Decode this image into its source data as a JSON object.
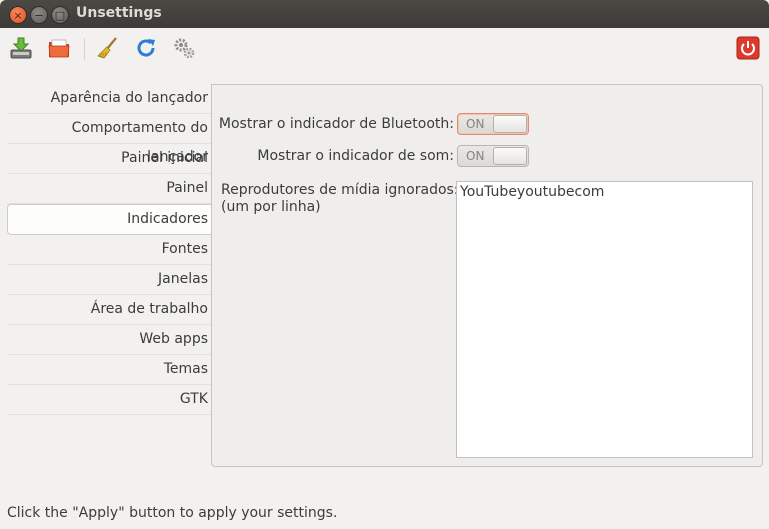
{
  "window": {
    "title": "Unsettings",
    "close": "×",
    "minimize": "−",
    "maximize": "□"
  },
  "toolbar": {
    "icons": [
      "save-icon",
      "folder-open-icon",
      "broom-icon",
      "refresh-icon",
      "gears-icon",
      "power-icon"
    ],
    "colors": {
      "save": "#5fa832",
      "folder": "#e8552a",
      "refresh": "#2a7fd4",
      "power": "#df382c"
    }
  },
  "sidebar": {
    "items": [
      {
        "label": "Aparência do lançador"
      },
      {
        "label": "Comportamento do lançador"
      },
      {
        "label": "Painel inicial"
      },
      {
        "label": "Painel"
      },
      {
        "label": "Indicadores",
        "active": true
      },
      {
        "label": "Fontes"
      },
      {
        "label": "Janelas"
      },
      {
        "label": "Área de trabalho"
      },
      {
        "label": "Web apps"
      },
      {
        "label": "Temas"
      },
      {
        "label": "GTK"
      }
    ]
  },
  "panel": {
    "bluetooth": {
      "label": "Mostrar o indicador de Bluetooth:",
      "state": "ON"
    },
    "sound": {
      "label": "Mostrar o indicador de som:",
      "state": "ON"
    },
    "media": {
      "label_line1": "Reprodutores de mídia ignorados:",
      "label_line2": "(um por linha)",
      "value": "YouTubeyoutubecom"
    }
  },
  "status": {
    "text": "Click the \"Apply\" button to apply your settings."
  }
}
